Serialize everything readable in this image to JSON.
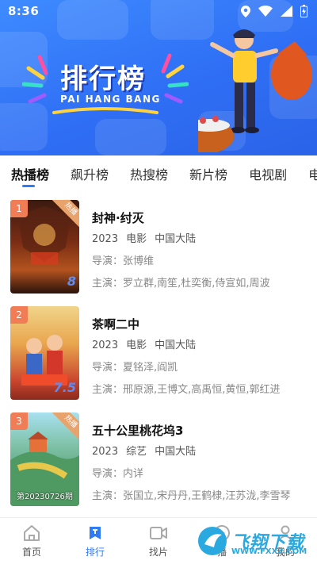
{
  "status_bar": {
    "time": "8:36"
  },
  "banner": {
    "title": "排行榜",
    "subtitle": "PAI HANG BANG"
  },
  "tabs": [
    {
      "label": "热播榜",
      "active": true
    },
    {
      "label": "飙升榜",
      "active": false
    },
    {
      "label": "热搜榜",
      "active": false
    },
    {
      "label": "新片榜",
      "active": false
    },
    {
      "label": "电视剧",
      "active": false
    },
    {
      "label": "电影",
      "active": false
    }
  ],
  "items": [
    {
      "rank": "1",
      "badge": "热播",
      "score": "8",
      "title": "封神·纣灭",
      "year": "2023",
      "type": "电影",
      "region": "中国大陆",
      "director_label": "导演：",
      "director": "张博维",
      "cast_label": "主演：",
      "cast": "罗立群,南笙,杜奕衡,侍宣如,周波",
      "poster_colors": [
        "#3a1a10",
        "#b3531f"
      ]
    },
    {
      "rank": "2",
      "badge": "",
      "score": "7.5",
      "title": "茶啊二中",
      "year": "2023",
      "type": "电影",
      "region": "中国大陆",
      "director_label": "导演：",
      "director": "夏铭泽,阎凯",
      "cast_label": "主演：",
      "cast": "邢原源,王博文,高禹恒,黄恒,郭红进",
      "poster_colors": [
        "#e9c06a",
        "#c9452e"
      ]
    },
    {
      "rank": "3",
      "badge": "热播",
      "score": "",
      "title": "五十公里桃花坞3",
      "year": "2023",
      "type": "综艺",
      "region": "中国大陆",
      "director_label": "导演：",
      "director": "内详",
      "cast_label": "主演：",
      "cast": "张国立,宋丹丹,王鹤棣,汪苏泷,李雪琴",
      "poster_date": "第20230726期",
      "poster_colors": [
        "#7fc2a8",
        "#3d8a5e"
      ]
    }
  ],
  "bottom_nav": [
    {
      "label": "首页",
      "icon": "home-icon",
      "active": false
    },
    {
      "label": "排行",
      "icon": "rank-icon",
      "active": true
    },
    {
      "label": "找片",
      "icon": "video-icon",
      "active": false
    },
    {
      "label": "播",
      "icon": "play-icon",
      "active": false
    },
    {
      "label": "我的",
      "icon": "user-icon",
      "active": false
    }
  ],
  "watermark": {
    "text": "飞翔下载",
    "url": "WWW.FXXZ.COM"
  },
  "colors": {
    "accent": "#2f7bf6",
    "hero": "#3a82fb",
    "rank_badge": "#f07d55"
  }
}
